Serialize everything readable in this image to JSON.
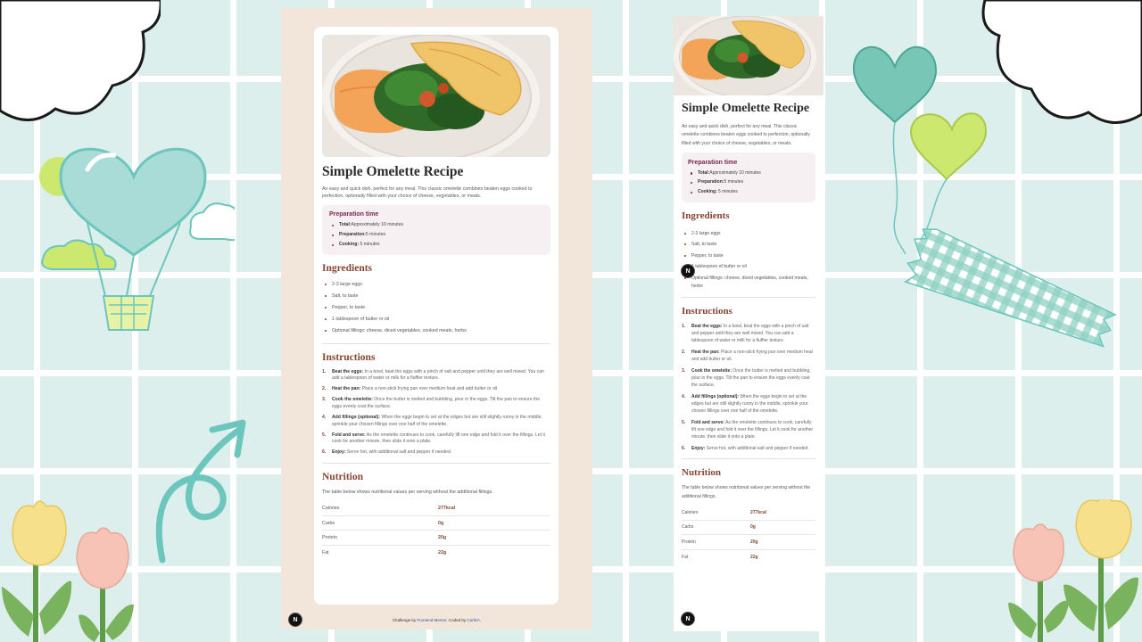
{
  "desktop": {
    "title": "Simple Omelette Recipe",
    "description": "An easy and quick dish, perfect for any meal. This classic omelette combines beaten eggs cooked to perfection, optionally filled with your choice of cheese, vegetables, or meats.",
    "prep": {
      "title": "Preparation time",
      "items": [
        {
          "label": "Total:",
          "value": "Approximately 10 minutes"
        },
        {
          "label": "Preparation:",
          "value": "5 minutes"
        },
        {
          "label": "Cooking:",
          "value": " 5 minutes"
        }
      ]
    },
    "ingredients": {
      "title": "Ingredients",
      "items": [
        "2-3 large eggs",
        "Salt, to taste",
        "Pepper, to taste",
        "1 tablespoon of butter or oil",
        "Optional fillings: cheese, diced vegetables, cooked meats, herbs"
      ]
    },
    "instructions": {
      "title": "Instructions",
      "items": [
        {
          "num": "1.",
          "label": "Beat the eggs:",
          "text": " In a bowl, beat the eggs with a pinch of salt and pepper until they are well mixed. You can add a tablespoon of water or milk for a fluffier texture."
        },
        {
          "num": "2.",
          "label": "Heat the pan:",
          "text": " Place a non-stick frying pan over medium heat and add butter or oil."
        },
        {
          "num": "3.",
          "label": "Cook the omelette:",
          "text": " Once the butter is melted and bubbling, pour in the eggs. Tilt the pan to ensure the eggs evenly coat the surface."
        },
        {
          "num": "4.",
          "label": "Add fillings (optional):",
          "text": " When the eggs begin to set at the edges but are still slightly runny in the middle, sprinkle your chosen fillings over one half of the omelette."
        },
        {
          "num": "5.",
          "label": "Fold and serve:",
          "text": " As the omelette continues to cook, carefully lift one edge and fold it over the fillings. Let it cook for another minute, then slide it onto a plate."
        },
        {
          "num": "6.",
          "label": "Enjoy:",
          "text": " Serve hot, with additional salt and pepper if needed."
        }
      ]
    },
    "nutrition": {
      "title": "Nutrition",
      "intro": "The table below shows nutritional values per serving without the additional fillings.",
      "rows": [
        {
          "k": "Calories",
          "v": "277kcal"
        },
        {
          "k": "Carbs",
          "v": "0g"
        },
        {
          "k": "Protein",
          "v": "20g"
        },
        {
          "k": "Fat",
          "v": "22g"
        }
      ]
    },
    "attribution": {
      "prefix": "Challenge by ",
      "link1": "Frontend Mentor",
      "mid": ". Coded by ",
      "link2": "CarlDA",
      "suffix": "."
    }
  },
  "badge": "N",
  "colors": {
    "background": "#dcefed",
    "panel": "#f2e5da",
    "accent_brown": "#854632",
    "accent_rose": "#7a284e"
  }
}
